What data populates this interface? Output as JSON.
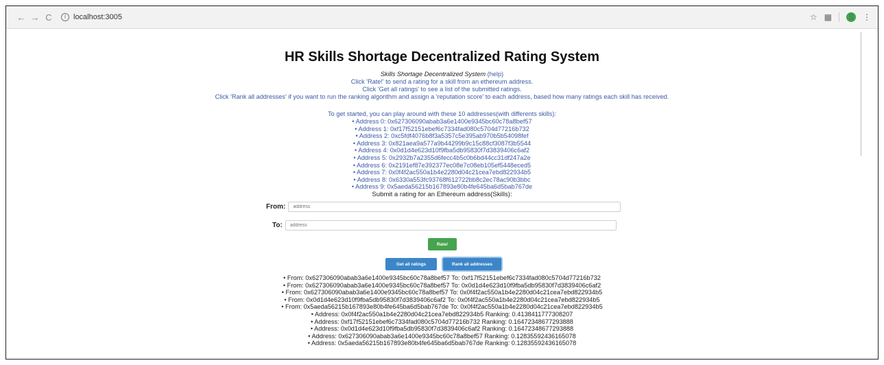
{
  "browser": {
    "url": "localhost:3005",
    "back_icon": "back-arrow-icon",
    "forward_icon": "forward-arrow-icon",
    "reload_icon": "reload-icon",
    "avatar_letter": "S"
  },
  "page": {
    "title": "HR Skills Shortage Decentralized Rating System",
    "system_name": "Skills Shortage Decentralized System",
    "help_link": "(help)",
    "intro_lines": [
      "Click 'Rate!' to send a rating for a skill from an ethereum address.",
      "Click 'Get all ratings' to see a list of the submitted ratings.",
      "Click 'Rank all addresses' if you want to run the ranking algorithm and assign a 'reputation score' to each address, based how many ratings each skill has received."
    ],
    "started_text": "To get started, you can play around with these 10 addresses(with differents skills):",
    "addresses": [
      "Address 0: 0x627306090abab3a6e1400e9345bc60c78a8bef57",
      "Address 1: 0xf17f52151ebef6c7334fad080c5704d77216b732",
      "Address 2: 0xc5fdf4076b8f3a5357c5e395ab970b5b54098fef",
      "Address 3: 0x821aea9a577a9b44299b9c15c88cf3087f3b5544",
      "Address 4: 0x0d1d4e623d10f9fba5db95830f7d3839406c6af2",
      "Address 5: 0x2932b7a2355d6fecc4b5c0b6bd44cc31df247a2e",
      "Address 6: 0x2191ef87e392377ec08e7c08eb105ef5448eced5",
      "Address 7: 0x0f4f2ac550a1b4e2280d04c21cea7ebd822934b5",
      "Address 8: 0x6330a553fc93768f612722bb8c2ec78ac90b3bbc",
      "Address 9: 0x5aeda56215b167893e80b4fe645ba6d5bab767de"
    ],
    "submit_title": "Submit a rating for an Ethereum address(Skills):"
  },
  "form": {
    "from_label": "From:",
    "from_placeholder": "address",
    "to_label": "To:",
    "to_placeholder": "address",
    "rate_button": "Rate!",
    "get_all_button": "Get all ratings",
    "rank_all_button": "Rank all addresses"
  },
  "ratings": [
    "From: 0x627306090abab3a6e1400e9345bc60c78a8bef57 To: 0xf17f52151ebef6c7334fad080c5704d77216b732",
    "From: 0x627306090abab3a6e1400e9345bc60c78a8bef57 To: 0x0d1d4e623d10f9fba5db95830f7d3839406c6af2",
    "From: 0x627306090abab3a6e1400e9345bc60c78a8bef57 To: 0x0f4f2ac550a1b4e2280d04c21cea7ebd822934b5",
    "From: 0x0d1d4e623d10f9fba5db95830f7d3839406c6af2 To: 0x0f4f2ac550a1b4e2280d04c21cea7ebd822934b5",
    "From: 0x5aeda56215b167893e80b4fe645ba6d5bab767de To: 0x0f4f2ac550a1b4e2280d04c21cea7ebd822934b5"
  ],
  "rankings": [
    "Address: 0x0f4f2ac550a1b4e2280d04c21cea7ebd822934b5 Ranking: 0.4138411777308207",
    "Address: 0xf17f52151ebef6c7334fad080c5704d77216b732 Ranking: 0.16472348677293888",
    "Address: 0x0d1d4e623d10f9fba5db95830f7d3839406c6af2 Ranking: 0.16472348677293888",
    "Address: 0x627306090abab3a6e1400e9345bc60c78a8bef57 Ranking: 0.12835592436165078",
    "Address: 0x5aeda56215b167893e80b4fe645ba6d5bab767de Ranking: 0.12835592436165078"
  ]
}
